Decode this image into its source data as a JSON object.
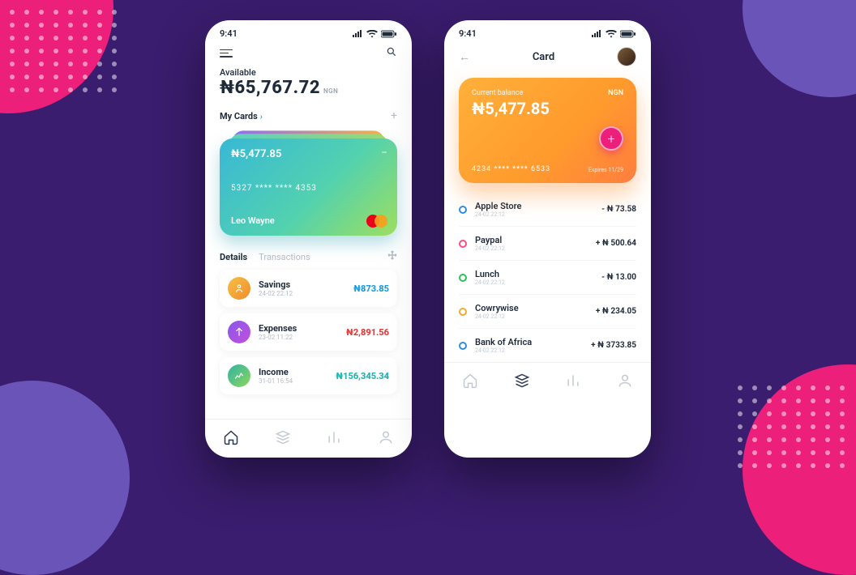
{
  "status": {
    "time": "9:41"
  },
  "screen1": {
    "available_label": "Available",
    "balance": "₦65,767.72",
    "currency": "NGN",
    "mycards_label": "My Cards",
    "card": {
      "balance": "₦5,477.85",
      "number": "5327  ****  ****  4353",
      "holder": "Leo Wayne"
    },
    "tabs": {
      "details": "Details",
      "transactions": "Transactions"
    },
    "details": [
      {
        "name": "Savings",
        "date": "24-02  22:12",
        "amount": "₦873.85",
        "cls": "blue",
        "icon": "savings"
      },
      {
        "name": "Expenses",
        "date": "23-02  11:22",
        "amount": "₦2,891.56",
        "cls": "red",
        "icon": "expenses"
      },
      {
        "name": "Income",
        "date": "31-01  16:54",
        "amount": "₦156,345.34",
        "cls": "teal",
        "icon": "income"
      }
    ]
  },
  "screen2": {
    "title": "Card",
    "card": {
      "label": "Current balance",
      "balance": "₦5,477.85",
      "currency": "NGN",
      "number": "4234 **** **** 6533",
      "expires": "Expires 11/29"
    },
    "transactions": [
      {
        "name": "Apple Store",
        "date": "24-02  22:12",
        "amount": "- ₦ 73.58"
      },
      {
        "name": "Paypal",
        "date": "24-02  22:12",
        "amount": "+ ₦ 500.64"
      },
      {
        "name": "Lunch",
        "date": "24-02  22:12",
        "amount": "- ₦ 13.00"
      },
      {
        "name": "Cowrywise",
        "date": "24-02  22:12",
        "amount": "+ ₦ 234.05"
      },
      {
        "name": "Bank of Africa",
        "date": "24-02  22:12",
        "amount": "+ ₦ 3733.85"
      }
    ]
  }
}
